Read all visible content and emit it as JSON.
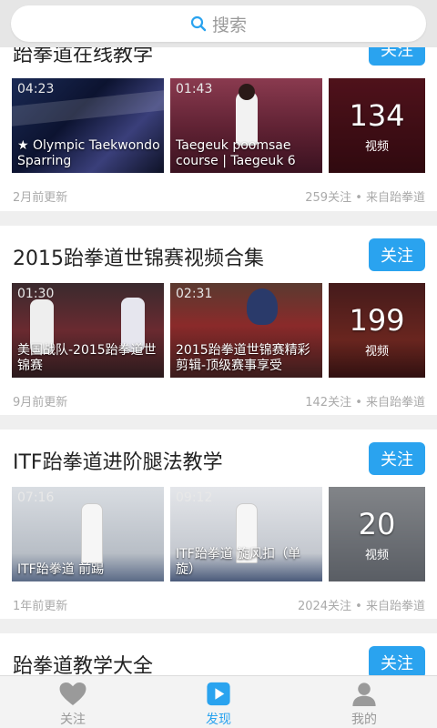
{
  "search": {
    "placeholder": "搜索"
  },
  "colors": {
    "accent": "#2aa3ef",
    "background": "#efefef"
  },
  "cards": [
    {
      "title": "跆拳道在线教学",
      "follow_label": "关注",
      "videos": [
        {
          "duration": "04:23",
          "caption": "★ Olympic Taekwondo Sparring"
        },
        {
          "duration": "01:43",
          "caption": "Taegeuk poomsae course | Taegeuk 6"
        }
      ],
      "more": {
        "count": "134",
        "label": "视频"
      },
      "updated": "2月前更新",
      "stats": "259关注 • 来自跆拳道"
    },
    {
      "title": "2015跆拳道世锦赛视频合集",
      "follow_label": "关注",
      "videos": [
        {
          "duration": "01:30",
          "caption": "美国战队-2015跆拳道世锦赛"
        },
        {
          "duration": "02:31",
          "caption": "2015跆拳道世锦赛精彩剪辑-顶级赛事享受"
        }
      ],
      "more": {
        "count": "199",
        "label": "视频"
      },
      "updated": "9月前更新",
      "stats": "142关注 • 来自跆拳道"
    },
    {
      "title": "ITF跆拳道进阶腿法教学",
      "follow_label": "关注",
      "videos": [
        {
          "duration": "07:16",
          "caption": "ITF跆拳道 前踢"
        },
        {
          "duration": "09:12",
          "caption": "ITF跆拳道 旋风扣（单旋）"
        }
      ],
      "more": {
        "count": "20",
        "label": "视频"
      },
      "updated": "1年前更新",
      "stats": "2024关注 • 来自跆拳道"
    },
    {
      "title": "跆拳道教学大全",
      "follow_label": "关注"
    }
  ],
  "tabs": [
    {
      "label": "关注",
      "icon": "heart-icon",
      "active": false
    },
    {
      "label": "发现",
      "icon": "play-icon",
      "active": true
    },
    {
      "label": "我的",
      "icon": "person-icon",
      "active": false
    }
  ]
}
